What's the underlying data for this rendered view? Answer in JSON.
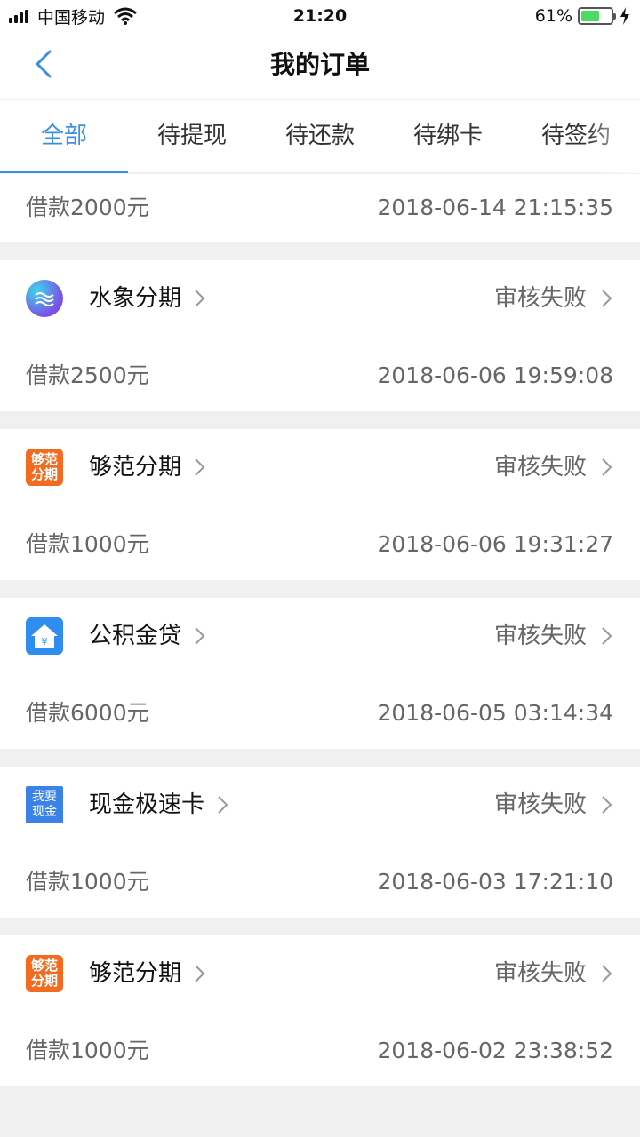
{
  "status_bar": {
    "carrier": "中国移动",
    "time": "21:20",
    "battery": "61%",
    "battery_level": 0.61
  },
  "nav": {
    "title": "我的订单",
    "back_icon": "chevron-left-icon"
  },
  "tabs": [
    {
      "label": "全部",
      "active": true
    },
    {
      "label": "待提现",
      "active": false
    },
    {
      "label": "待还款",
      "active": false
    },
    {
      "label": "待绑卡",
      "active": false
    },
    {
      "label": "待签约",
      "active": false
    }
  ],
  "partial_order": {
    "amount": "借款2000元",
    "time": "2018-06-14 21:15:35"
  },
  "orders": [
    {
      "name": "水象分期",
      "logo": "wave-logo",
      "status": "审核失败",
      "amount": "借款2500元",
      "time": "2018-06-06 19:59:08"
    },
    {
      "name": "够范分期",
      "logo": "gf-logo",
      "logo_text": [
        "够范",
        "分期"
      ],
      "status": "审核失败",
      "amount": "借款1000元",
      "time": "2018-06-06 19:31:27"
    },
    {
      "name": "公积金贷",
      "logo": "house-logo",
      "status": "审核失败",
      "amount": "借款6000元",
      "time": "2018-06-05 03:14:34"
    },
    {
      "name": "现金极速卡",
      "logo": "cash-logo",
      "logo_text": [
        "我要",
        "现金"
      ],
      "status": "审核失败",
      "amount": "借款1000元",
      "time": "2018-06-03 17:21:10"
    },
    {
      "name": "够范分期",
      "logo": "gf-logo",
      "logo_text": [
        "够范",
        "分期"
      ],
      "status": "审核失败",
      "amount": "借款1000元",
      "time": "2018-06-02 23:38:52"
    }
  ],
  "colors": {
    "accent": "#3b8fe0",
    "background": "#f0f0f0",
    "battery": "#4cd964"
  }
}
